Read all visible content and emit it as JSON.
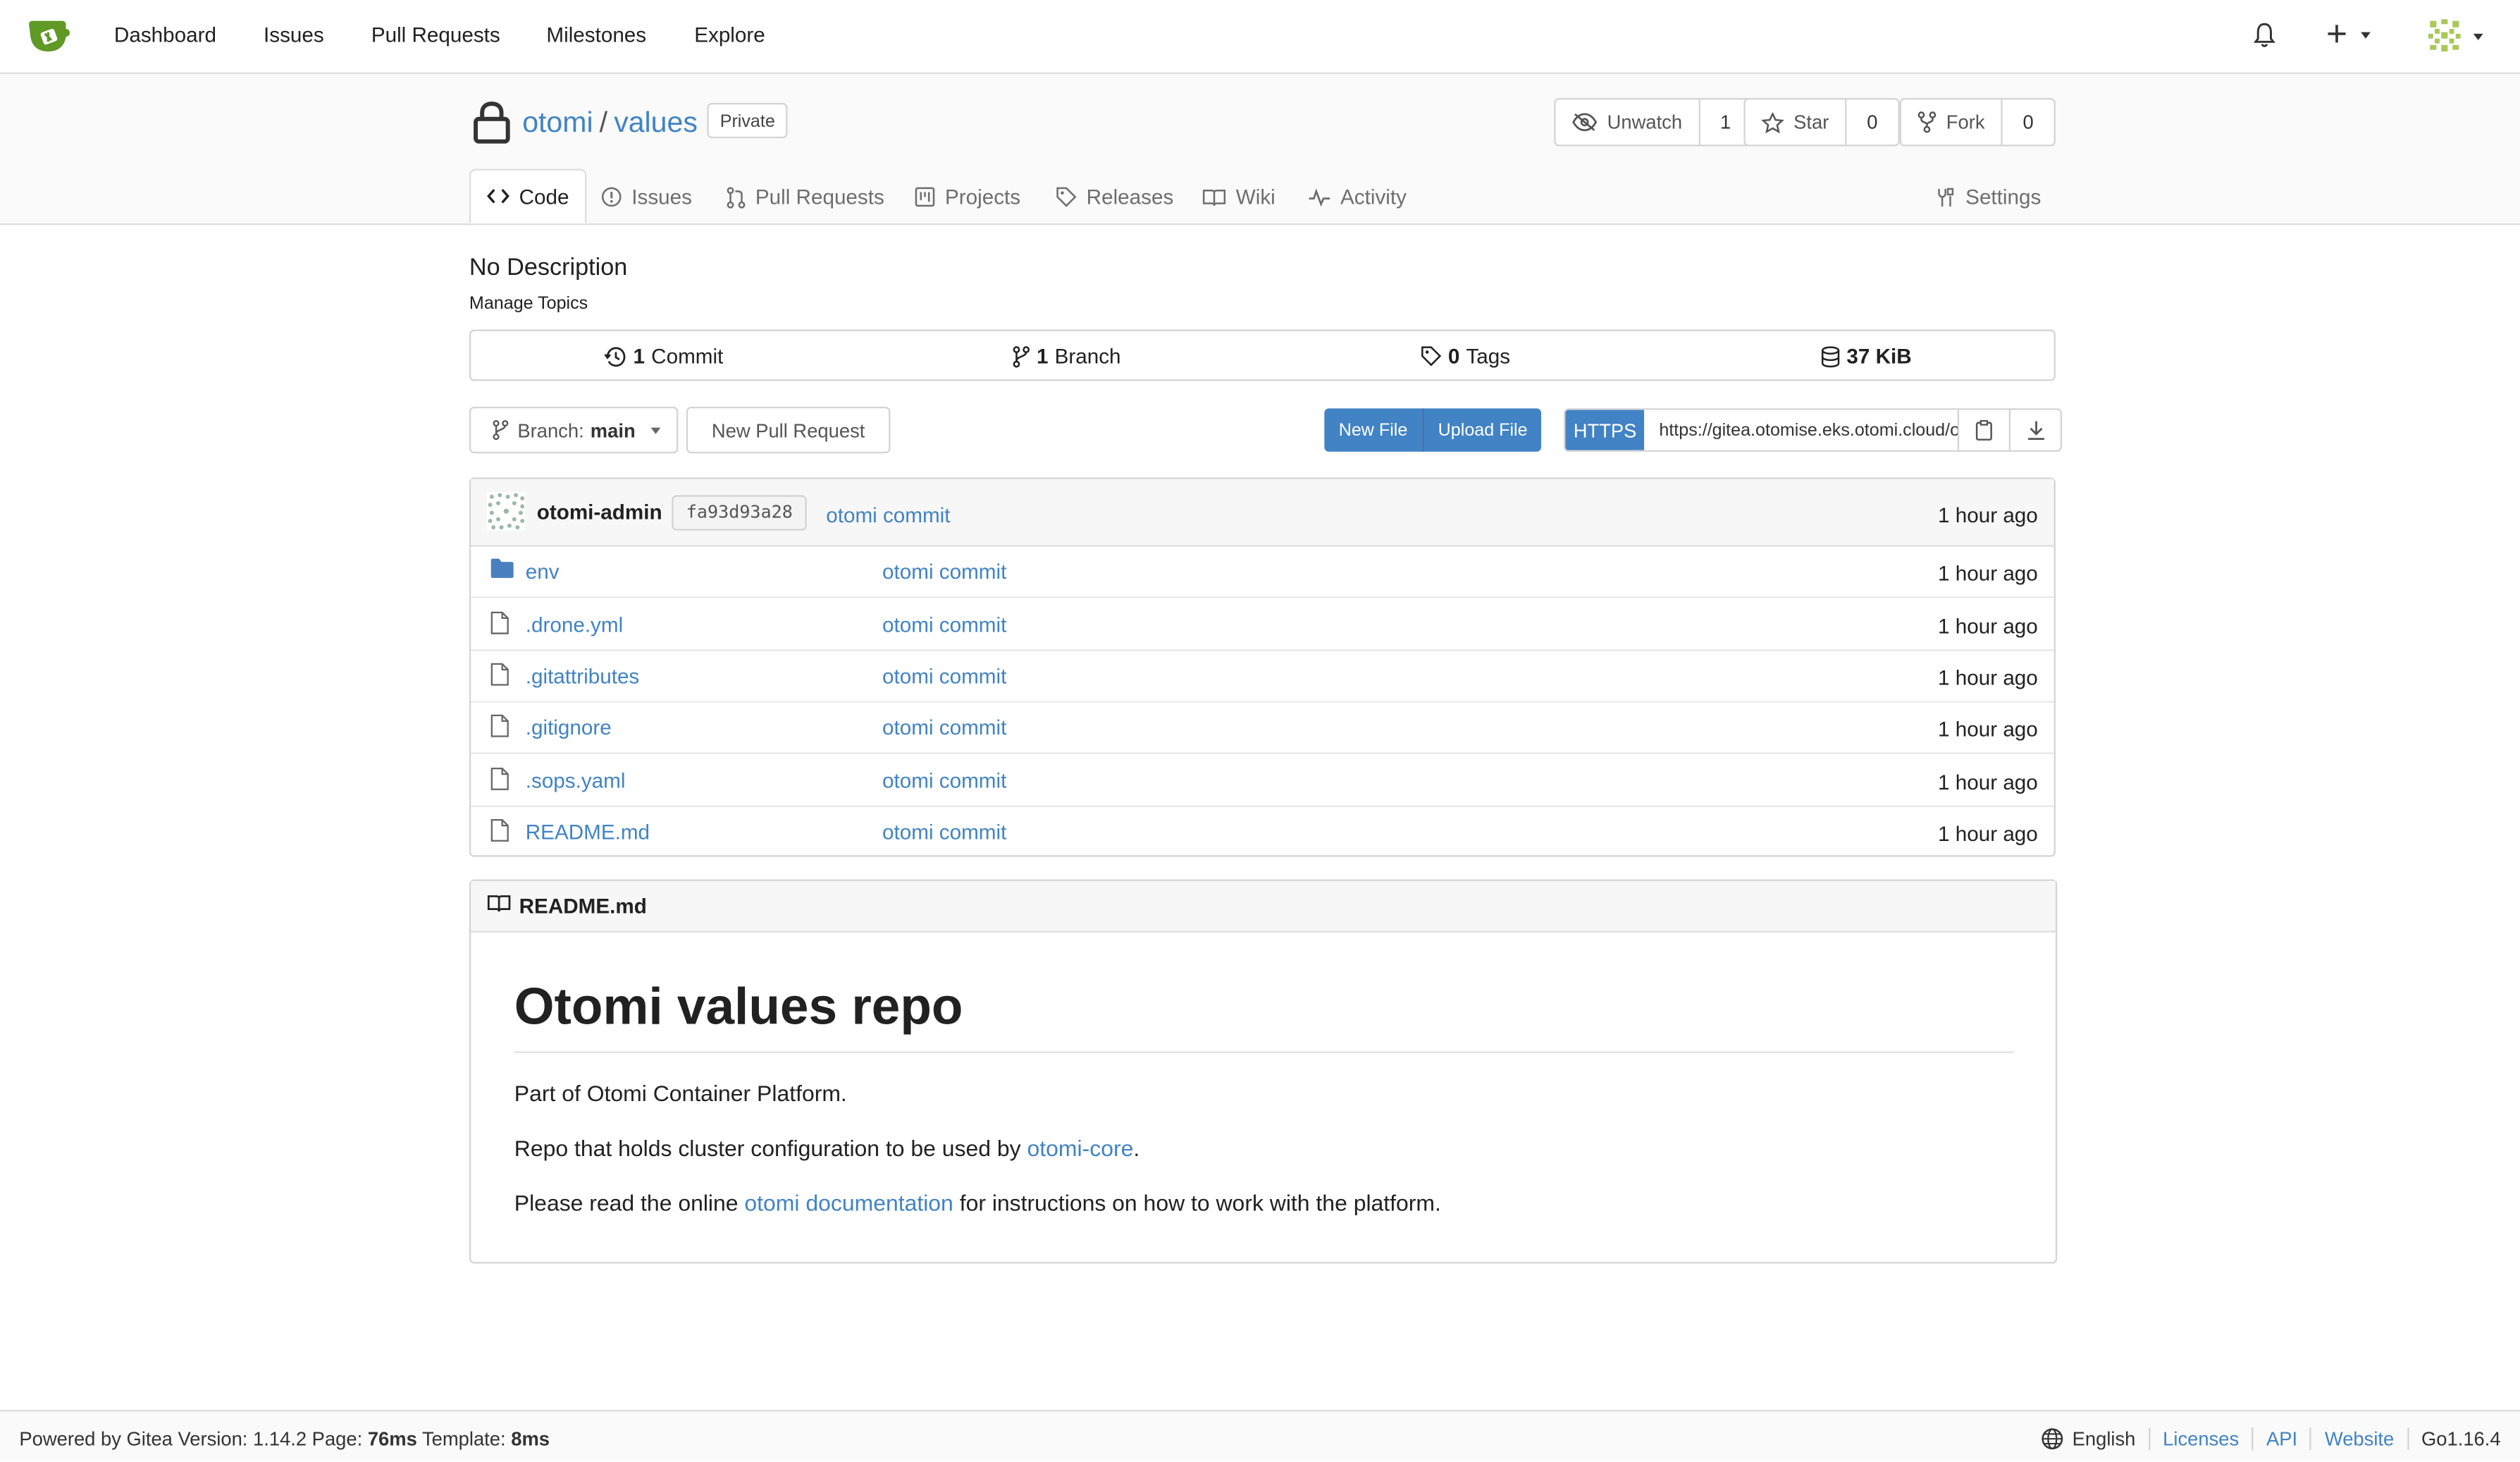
{
  "nav": {
    "items": [
      "Dashboard",
      "Issues",
      "Pull Requests",
      "Milestones",
      "Explore"
    ]
  },
  "repo": {
    "owner": "otomi",
    "separator": "/",
    "name": "values",
    "visibility": "Private",
    "watch": {
      "label": "Unwatch",
      "count": "1"
    },
    "star": {
      "label": "Star",
      "count": "0"
    },
    "fork": {
      "label": "Fork",
      "count": "0"
    },
    "tabs": [
      "Code",
      "Issues",
      "Pull Requests",
      "Projects",
      "Releases",
      "Wiki",
      "Activity"
    ],
    "settings": "Settings"
  },
  "summary": {
    "description": "No Description",
    "manage_topics": "Manage Topics",
    "commits": {
      "count": "1",
      "label": "Commit"
    },
    "branches": {
      "count": "1",
      "label": "Branch"
    },
    "tags": {
      "count": "0",
      "label": "Tags"
    },
    "size": "37 KiB"
  },
  "toolbar": {
    "branch_prefix": "Branch:",
    "branch": "main",
    "new_pull_request": "New Pull Request",
    "new_file": "New File",
    "upload_file": "Upload File",
    "clone_protocol": "HTTPS",
    "clone_url": "https://gitea.otomise.eks.otomi.cloud/otomi/values.git"
  },
  "latest_commit": {
    "author": "otomi-admin",
    "sha": "fa93d93a28",
    "message": "otomi commit",
    "time": "1 hour ago"
  },
  "files": [
    {
      "name": "env",
      "type": "dir",
      "message": "otomi commit",
      "time": "1 hour ago"
    },
    {
      "name": ".drone.yml",
      "type": "file",
      "message": "otomi commit",
      "time": "1 hour ago"
    },
    {
      "name": ".gitattributes",
      "type": "file",
      "message": "otomi commit",
      "time": "1 hour ago"
    },
    {
      "name": ".gitignore",
      "type": "file",
      "message": "otomi commit",
      "time": "1 hour ago"
    },
    {
      "name": ".sops.yaml",
      "type": "file",
      "message": "otomi commit",
      "time": "1 hour ago"
    },
    {
      "name": "README.md",
      "type": "file",
      "message": "otomi commit",
      "time": "1 hour ago"
    }
  ],
  "readme": {
    "filename": "README.md",
    "heading": "Otomi values repo",
    "p1": "Part of Otomi Container Platform.",
    "p2_before": "Repo that holds cluster configuration to be used by ",
    "p2_link": "otomi-core",
    "p2_after": ".",
    "p3_before": "Please read the online ",
    "p3_link": "otomi documentation",
    "p3_after": " for instructions on how to work with the platform."
  },
  "footer": {
    "powered": "Powered by Gitea Version: 1.14.2 Page: ",
    "page_time": "76ms",
    "template_label": " Template: ",
    "template_time": "8ms",
    "language": "English",
    "licenses": "Licenses",
    "api": "API",
    "website": "Website",
    "go_version": "Go1.16.4"
  },
  "colors": {
    "accent": "#4183c4",
    "logo": "#609926"
  },
  "icons": {
    "logo": "gitea-logo-icon",
    "bell": "bell-icon",
    "plus": "plus-icon",
    "lock": "lock-icon",
    "folder": "folder-icon",
    "file": "file-icon",
    "book": "book-icon",
    "globe": "globe-icon"
  }
}
